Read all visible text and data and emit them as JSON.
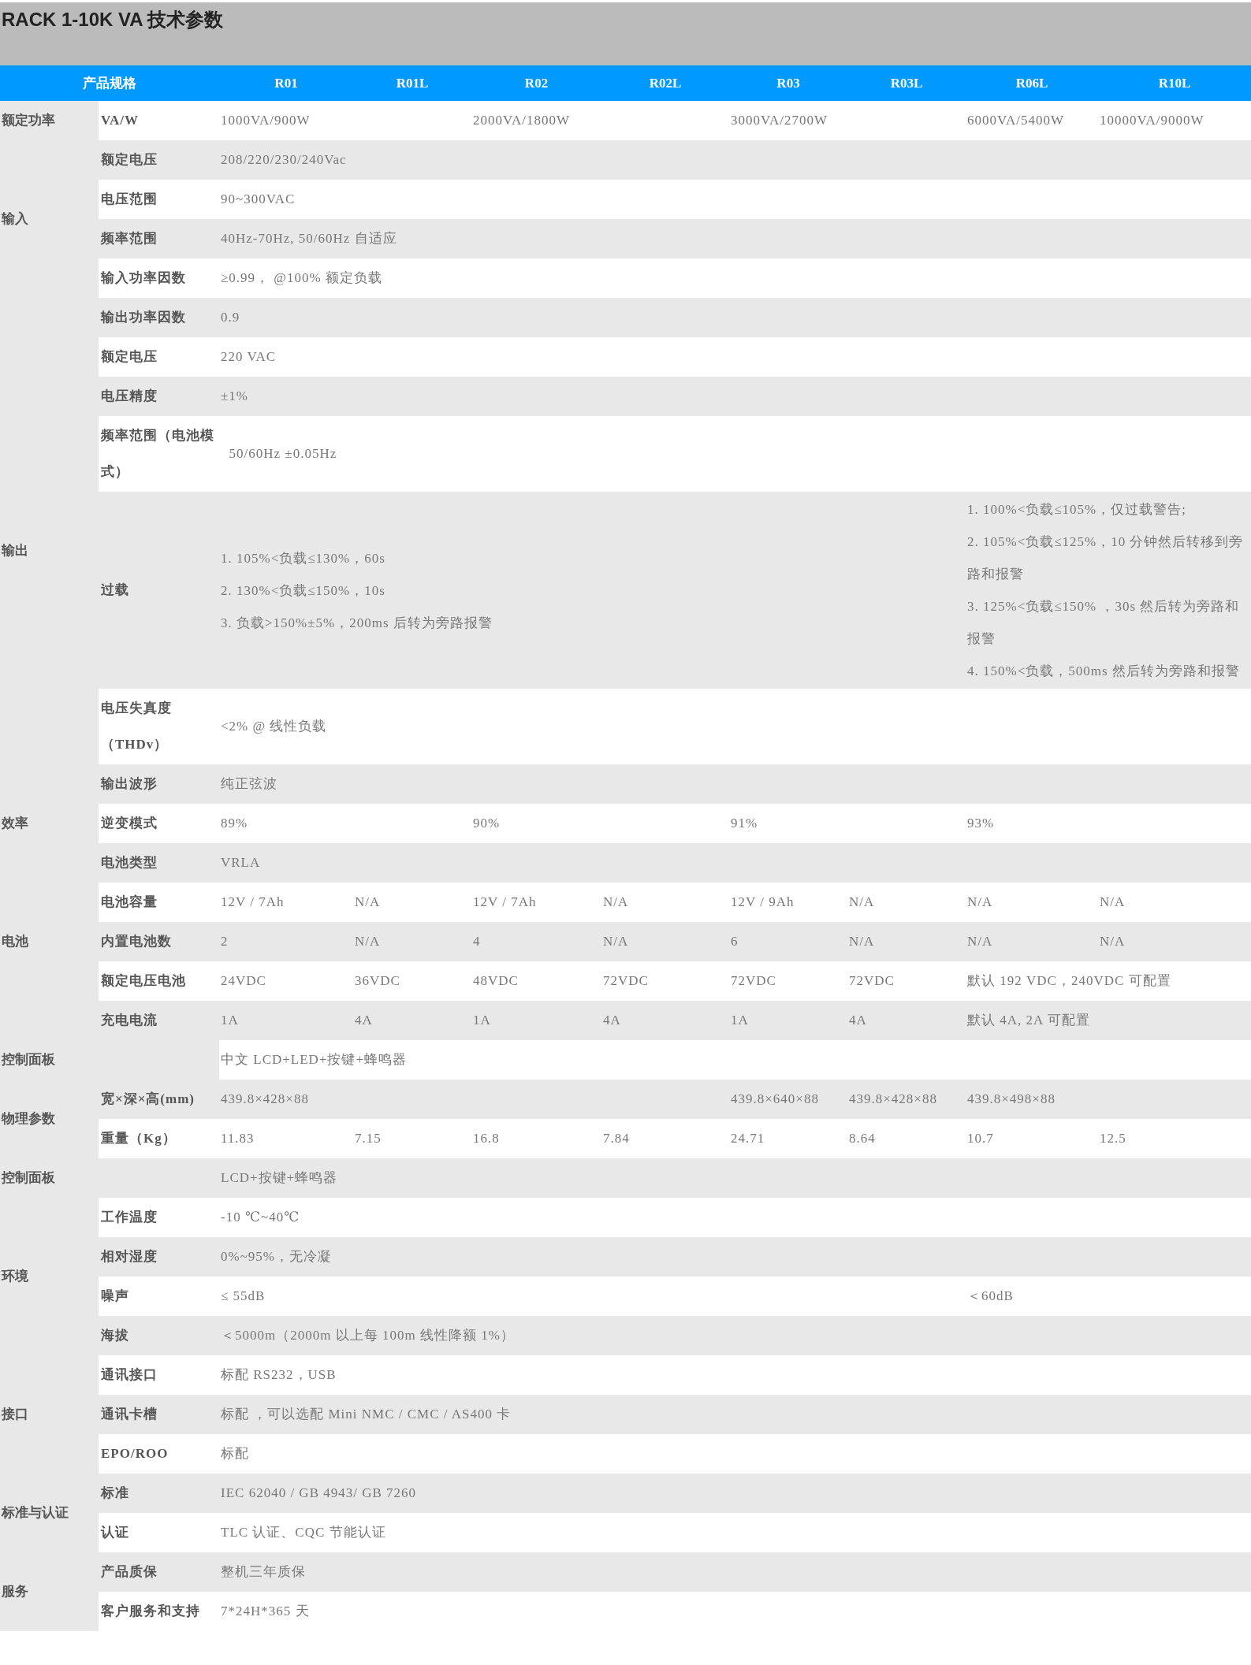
{
  "title": "RACK 1-10K VA 技术参数",
  "header": [
    "产品规格",
    "R01",
    "R01L",
    "R02",
    "R02L",
    "R03",
    "R03L",
    "R06L",
    "R10L"
  ],
  "groups": [
    {
      "category": "额定功率",
      "rows": [
        {
          "label": "VA/W",
          "cells": [
            {
              "text": "1000VA/900W",
              "colspan": 2
            },
            {
              "text": "2000VA/1800W",
              "colspan": 2
            },
            {
              "text": "3000VA/2700W",
              "colspan": 2
            },
            {
              "text": "6000VA/5400W"
            },
            {
              "text": "10000VA/9000W"
            }
          ]
        }
      ]
    },
    {
      "category": "输入",
      "rows": [
        {
          "label": "额定电压",
          "cells": [
            {
              "text": "208/220/230/240Vac",
              "colspan": 8
            }
          ]
        },
        {
          "label": "电压范围",
          "cells": [
            {
              "text": "90~300VAC",
              "colspan": 8
            }
          ]
        },
        {
          "label": "频率范围",
          "cells": [
            {
              "text": "40Hz-70Hz, 50/60Hz 自适应",
              "colspan": 8
            }
          ]
        },
        {
          "label": "输入功率因数",
          "cells": [
            {
              "text": "≥0.99， @100% 额定负载",
              "colspan": 8
            }
          ]
        }
      ]
    },
    {
      "category": "输出",
      "rows": [
        {
          "label": "输出功率因数",
          "cells": [
            {
              "text": "0.9",
              "colspan": 8
            }
          ]
        },
        {
          "label": "额定电压",
          "cells": [
            {
              "text": "220 VAC",
              "colspan": 8
            }
          ]
        },
        {
          "label": "电压精度",
          "cells": [
            {
              "text": "±1%",
              "colspan": 8
            }
          ]
        },
        {
          "label": "频率范围（电池模式）",
          "cells": [
            {
              "text": "  50/60Hz ±0.05Hz",
              "colspan": 8
            }
          ]
        },
        {
          "label": "过载",
          "cells": [
            {
              "lines": [
                "1. 105%<负载≤130%，60s",
                "2. 130%<负载≤150%，10s",
                "3. 负载>150%±5%，200ms 后转为旁路报警"
              ],
              "colspan": 6
            },
            {
              "lines": [
                "1. 100%<负载≤105%，仅过载警告;",
                "2. 105%<负载≤125%，10 分钟然后转移到旁路和报警",
                "3. 125%<负载≤150% ，30s 然后转为旁路和报警",
                "4. 150%<负载，500ms 然后转为旁路和报警"
              ],
              "colspan": 2
            }
          ]
        },
        {
          "label": "电压失真度（THDv）",
          "cells": [
            {
              "text": "<2% @ 线性负载",
              "colspan": 8
            }
          ]
        },
        {
          "label": "输出波形",
          "cells": [
            {
              "text": "纯正弦波",
              "colspan": 8
            }
          ]
        }
      ]
    },
    {
      "category": "效率",
      "rows": [
        {
          "label": "逆变模式",
          "cells": [
            {
              "text": "89%",
              "colspan": 2
            },
            {
              "text": "90%",
              "colspan": 2
            },
            {
              "text": "91%",
              "colspan": 2
            },
            {
              "text": "93%",
              "colspan": 2
            }
          ]
        }
      ]
    },
    {
      "category": "电池",
      "rows": [
        {
          "label": "电池类型",
          "cells": [
            {
              "text": "VRLA",
              "colspan": 8
            }
          ]
        },
        {
          "label": "电池容量",
          "cells": [
            {
              "text": "12V / 7Ah"
            },
            {
              "text": "N/A"
            },
            {
              "text": "12V / 7Ah"
            },
            {
              "text": "N/A"
            },
            {
              "text": "12V / 9Ah"
            },
            {
              "text": "N/A"
            },
            {
              "text": "N/A"
            },
            {
              "text": "N/A"
            }
          ]
        },
        {
          "label": "内置电池数",
          "cells": [
            {
              "text": "2"
            },
            {
              "text": "N/A"
            },
            {
              "text": "4"
            },
            {
              "text": "N/A"
            },
            {
              "text": "6"
            },
            {
              "text": "N/A"
            },
            {
              "text": "N/A"
            },
            {
              "text": "N/A"
            }
          ]
        },
        {
          "label": "额定电压电池",
          "cells": [
            {
              "text": "24VDC"
            },
            {
              "text": "36VDC"
            },
            {
              "text": "48VDC"
            },
            {
              "text": "72VDC"
            },
            {
              "text": "72VDC"
            },
            {
              "text": "72VDC"
            },
            {
              "text": "默认 192 VDC，240VDC 可配置",
              "colspan": 2
            }
          ]
        },
        {
          "label": "充电电流",
          "cells": [
            {
              "text": "1A"
            },
            {
              "text": "4A"
            },
            {
              "text": "1A"
            },
            {
              "text": "4A"
            },
            {
              "text": "1A"
            },
            {
              "text": "4A"
            },
            {
              "text": "默认 4A, 2A 可配置",
              "colspan": 2
            }
          ]
        }
      ]
    },
    {
      "category": "控制面板",
      "rows": [
        {
          "cells": [
            {
              "text": "中文 LCD+LED+按键+蜂鸣器",
              "colspan": 8
            }
          ]
        }
      ]
    },
    {
      "category": "物理参数",
      "rows": [
        {
          "label": "宽×深×高(mm)",
          "cells": [
            {
              "text": "439.8×428×88",
              "colspan": 4
            },
            {
              "text": "439.8×640×88"
            },
            {
              "text": "439.8×428×88"
            },
            {
              "text": "439.8×498×88",
              "colspan": 2
            }
          ]
        },
        {
          "label": "重量（Kg）",
          "cells": [
            {
              "text": "11.83"
            },
            {
              "text": "7.15"
            },
            {
              "text": "16.8"
            },
            {
              "text": "7.84"
            },
            {
              "text": "24.71"
            },
            {
              "text": "8.64"
            },
            {
              "text": "10.7"
            },
            {
              "text": "12.5"
            }
          ]
        }
      ]
    },
    {
      "category": "控制面板",
      "rows": [
        {
          "cells": [
            {
              "text": "LCD+按键+蜂鸣器",
              "colspan": 8
            }
          ]
        }
      ]
    },
    {
      "category": "环境",
      "rows": [
        {
          "label": "工作温度",
          "cells": [
            {
              "text": "-10 ℃~40℃",
              "colspan": 8
            }
          ]
        },
        {
          "label": "相对湿度",
          "cells": [
            {
              "text": "0%~95%，无冷凝",
              "colspan": 8
            }
          ]
        },
        {
          "label": "噪声",
          "cells": [
            {
              "text": "≤ 55dB",
              "colspan": 6
            },
            {
              "text": "＜60dB",
              "colspan": 2
            }
          ]
        },
        {
          "label": "海拔",
          "cells": [
            {
              "text": "＜5000m（2000m 以上每 100m 线性降额 1%）",
              "colspan": 8
            }
          ]
        }
      ]
    },
    {
      "category": "接口",
      "rows": [
        {
          "label": "通讯接口",
          "cells": [
            {
              "text": "标配 RS232，USB",
              "colspan": 8
            }
          ]
        },
        {
          "label": "通讯卡槽",
          "cells": [
            {
              "text": "标配 ，可以选配 Mini NMC / CMC / AS400 卡",
              "colspan": 8
            }
          ]
        },
        {
          "label": "EPO/ROO",
          "cells": [
            {
              "text": "标配",
              "colspan": 8
            }
          ]
        }
      ]
    },
    {
      "category": "标准与认证",
      "rows": [
        {
          "label": "标准",
          "cells": [
            {
              "text": "IEC 62040 / GB 4943/ GB 7260",
              "colspan": 8
            }
          ]
        },
        {
          "label": "认证",
          "cells": [
            {
              "text": "TLC 认证、CQC 节能认证",
              "colspan": 8
            }
          ]
        }
      ]
    },
    {
      "category": "服务",
      "rows": [
        {
          "label": "产品质保",
          "cells": [
            {
              "text": "整机三年质保",
              "colspan": 8
            }
          ]
        },
        {
          "label": "客户服务和支持",
          "cells": [
            {
              "text": "7*24H*365 天",
              "colspan": 8
            }
          ]
        }
      ]
    }
  ]
}
